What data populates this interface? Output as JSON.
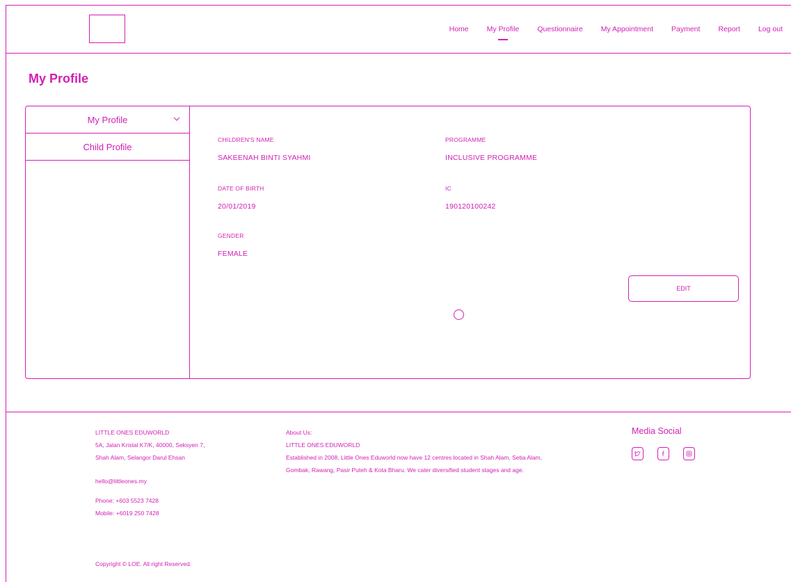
{
  "header": {
    "nav": [
      "Home",
      "My Profile",
      "Questionnaire",
      "My Appointment",
      "Payment",
      "Report",
      "Log out"
    ],
    "active_nav": "My Profile"
  },
  "page": {
    "title": "My Profile"
  },
  "sidebar": {
    "items": [
      {
        "label": "My Profile"
      },
      {
        "label": "Child Profile"
      }
    ]
  },
  "profile": {
    "children_name_label": "CHILDREN'S NAME",
    "children_name": "SAKEENAH BINTI SYAHMI",
    "programme_label": "PROGRAMME",
    "programme": "INCLUSIVE PROGRAMME",
    "dob_label": "DATE OF BIRTH",
    "dob": "20/01/2019",
    "ic_label": "IC",
    "ic": "190120100242",
    "gender_label": "GENDER",
    "gender": "FEMALE",
    "edit_label": "EDIT"
  },
  "footer": {
    "company": "LITTLE ONES EDUWORLD",
    "address_line1": "5A, Jalan Kristal K7/K, 40000, Seksyen 7,",
    "address_line2": "Shah Alam, Selangor Darul Ehsan",
    "email": "hello@littleones.my",
    "phone": "Phone: +603 5523 7428",
    "mobile": "Mobile: +6019 250 7428",
    "about_title": "About Us:",
    "about_company": "LITTLE ONES EDUWORLD",
    "about_line1": "Established in 2008, Little Ones Eduworld now have 12 centres located in Shah Alam, Setia Alam,",
    "about_line2": "Gombak, Rawang, Pasir Puteh & Kota Bharu.  We cater diversified student stages and age.",
    "media_title": "Media Social",
    "social_icons": [
      "twitter-icon",
      "facebook-icon",
      "instagram-icon"
    ],
    "copyright": "Copyright © LOE. All right Reserved."
  },
  "colors": {
    "accent": "#d21fb4",
    "background": "#ffffff"
  }
}
